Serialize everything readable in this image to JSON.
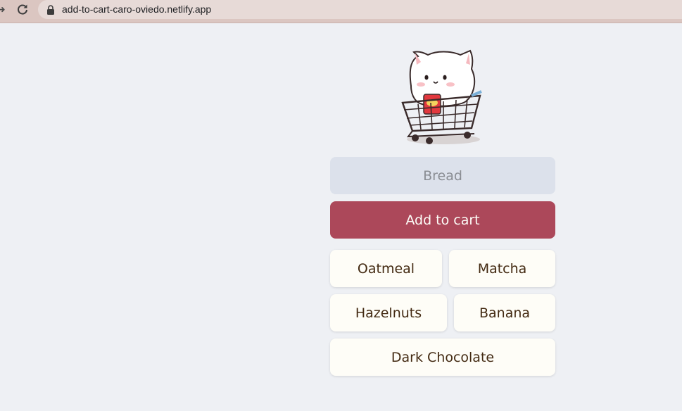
{
  "browser": {
    "url": "add-to-cart-caro-oviedo.netlify.app",
    "icons": {
      "forward": "forward-arrow-icon",
      "reload": "reload-icon",
      "lock": "lock-icon"
    }
  },
  "app": {
    "mascot": "cat-in-shopping-cart-illustration",
    "input": {
      "placeholder": "Bread",
      "value": ""
    },
    "add_button_label": "Add to cart",
    "items": [
      "Oatmeal",
      "Matcha",
      "Hazelnuts",
      "Banana",
      "Dark Chocolate"
    ],
    "colors": {
      "background": "#eef0f4",
      "button": "#ac485a",
      "input_bg": "#dce1eb",
      "item_bg": "#fefdf7",
      "item_text": "#432a12"
    }
  }
}
